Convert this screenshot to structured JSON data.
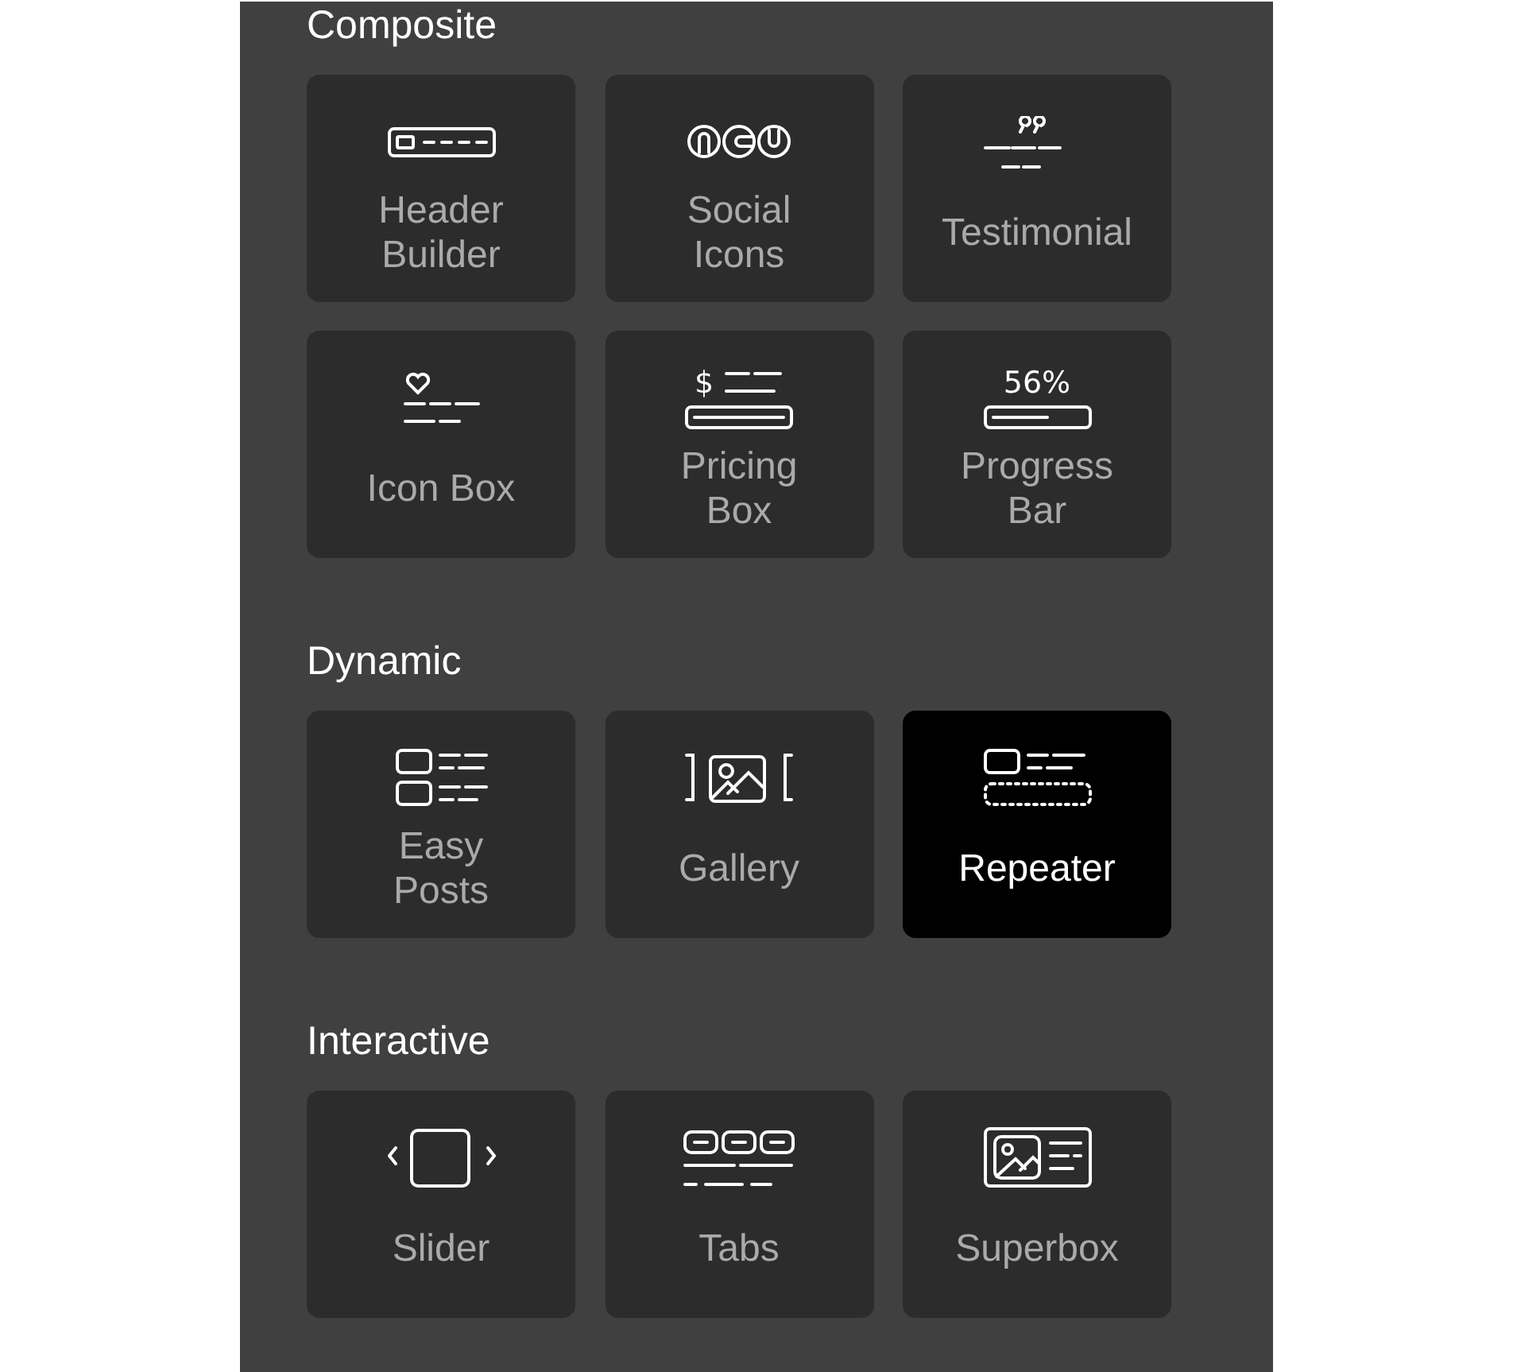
{
  "sections": [
    {
      "title": "Composite",
      "items": [
        {
          "label": "Header Builder",
          "kind": "header",
          "selected": false
        },
        {
          "label": "Social Icons",
          "kind": "social",
          "selected": false
        },
        {
          "label": "Testimonial",
          "kind": "testimonial",
          "selected": false
        },
        {
          "label": "Icon Box",
          "kind": "iconbox",
          "selected": false
        },
        {
          "label": "Pricing Box",
          "kind": "pricing",
          "icon_text": "$",
          "selected": false
        },
        {
          "label": "Progress Bar",
          "kind": "progress",
          "icon_text": "56%",
          "selected": false
        }
      ]
    },
    {
      "title": "Dynamic",
      "items": [
        {
          "label": "Easy Posts",
          "kind": "posts",
          "selected": false
        },
        {
          "label": "Gallery",
          "kind": "gallery",
          "selected": false
        },
        {
          "label": "Repeater",
          "kind": "repeater",
          "selected": true
        }
      ]
    },
    {
      "title": "Interactive",
      "items": [
        {
          "label": "Slider",
          "kind": "slider",
          "selected": false
        },
        {
          "label": "Tabs",
          "kind": "tabs",
          "selected": false
        },
        {
          "label": "Superbox",
          "kind": "superbox",
          "selected": false
        }
      ]
    }
  ]
}
